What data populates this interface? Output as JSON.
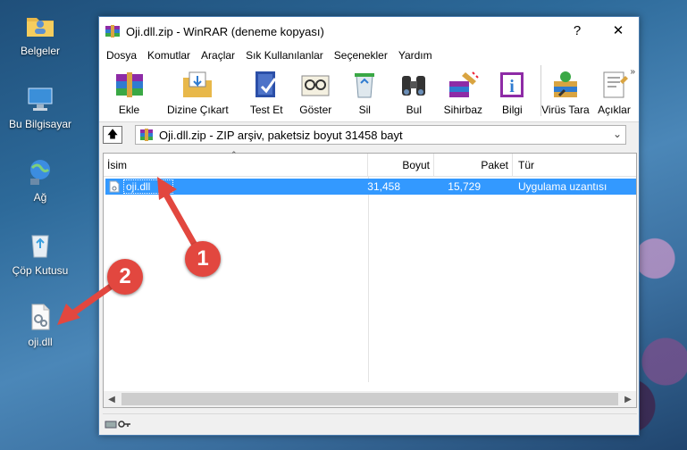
{
  "desktop": {
    "icons": [
      {
        "label": "Belgeler"
      },
      {
        "label": "Bu Bilgisayar"
      },
      {
        "label": "Ağ"
      },
      {
        "label": "Çöp Kutusu"
      },
      {
        "label": "oji.dll"
      }
    ]
  },
  "window": {
    "title": "Oji.dll.zip - WinRAR (deneme kopyası)",
    "help_label": "?",
    "close_label": "✕"
  },
  "menu": {
    "items": [
      "Dosya",
      "Komutlar",
      "Araçlar",
      "Sık Kullanılanlar",
      "Seçenekler",
      "Yardım"
    ]
  },
  "toolbar": {
    "items": [
      "Ekle",
      "Dizine Çıkart",
      "Test Et",
      "Göster",
      "Sil",
      "Bul",
      "Sihirbaz",
      "Bilgi",
      "Virüs Tara",
      "Açıklar"
    ],
    "more_label": "»"
  },
  "pathbar": {
    "up_label": "🡅",
    "path_text": "Oji.dll.zip - ZIP arşiv, paketsiz boyut 31458 bayt"
  },
  "filelist": {
    "headers": {
      "name": "İsim",
      "size": "Boyut",
      "packed": "Paket",
      "type": "Tür"
    },
    "rows": [
      {
        "name": "oji.dll",
        "size": "31,458",
        "packed": "15,729",
        "type": "Uygulama uzantısı"
      }
    ]
  },
  "annotations": {
    "badge_1": "1",
    "badge_2": "2"
  },
  "colors": {
    "selection": "#3399ff",
    "annotation_red": "#e2473f"
  }
}
